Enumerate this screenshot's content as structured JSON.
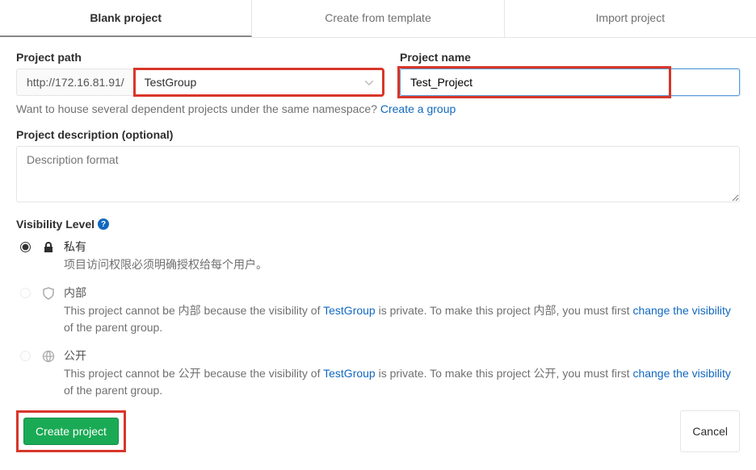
{
  "tabs": {
    "blank": "Blank project",
    "template": "Create from template",
    "import": "Import project"
  },
  "labels": {
    "project_path": "Project path",
    "project_name": "Project name",
    "project_desc": "Project description (optional)",
    "visibility": "Visibility Level"
  },
  "path": {
    "base_url": "http://172.16.81.91/",
    "group": "TestGroup"
  },
  "name": {
    "value": "Test_Project"
  },
  "hint_prefix": "Want to house several dependent projects under the same namespace? ",
  "hint_link": "Create a group",
  "desc_placeholder": "Description format",
  "visibility": {
    "private": {
      "title": "私有",
      "desc": "项目访问权限必须明确授权给每个用户。"
    },
    "internal": {
      "title": "内部",
      "pre": "This project cannot be 内部 because the visibility of ",
      "group": "TestGroup",
      "mid": " is private. To make this project 内部, you must first ",
      "link": "change the visibility",
      "post": " of the parent group."
    },
    "public": {
      "title": "公开",
      "pre": "This project cannot be 公开 because the visibility of ",
      "group": "TestGroup",
      "mid": " is private. To make this project 公开, you must first ",
      "link": "change the visibility",
      "post": " of the parent group."
    }
  },
  "buttons": {
    "create": "Create project",
    "cancel": "Cancel"
  }
}
